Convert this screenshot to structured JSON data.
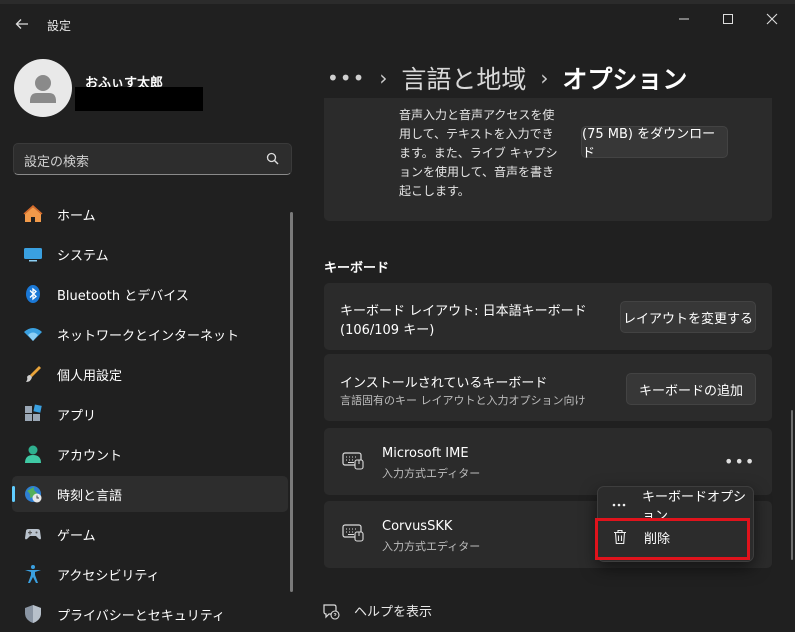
{
  "app": {
    "title": "設定"
  },
  "profile": {
    "name": "おふぃす太郎"
  },
  "search": {
    "placeholder": "設定の検索"
  },
  "nav": [
    {
      "label": "ホーム",
      "icon": "home-icon"
    },
    {
      "label": "システム",
      "icon": "system-icon"
    },
    {
      "label": "Bluetooth とデバイス",
      "icon": "bluetooth-icon"
    },
    {
      "label": "ネットワークとインターネット",
      "icon": "wifi-icon"
    },
    {
      "label": "個人用設定",
      "icon": "brush-icon"
    },
    {
      "label": "アプリ",
      "icon": "apps-icon"
    },
    {
      "label": "アカウント",
      "icon": "account-icon"
    },
    {
      "label": "時刻と言語",
      "icon": "time-language-icon",
      "active": true
    },
    {
      "label": "ゲーム",
      "icon": "game-controller-icon"
    },
    {
      "label": "アクセシビリティ",
      "icon": "accessibility-icon"
    },
    {
      "label": "プライバシーとセキュリティ",
      "icon": "shield-icon"
    }
  ],
  "breadcrumb": {
    "more": "•••",
    "parent": "言語と地域",
    "current": "オプション"
  },
  "speech": {
    "description": "音声入力と音声アクセスを使用して、テキストを入力できます。また、ライブ キャプションを使用して、音声を書き起こします。",
    "download_label": "(75 MB) をダウンロード"
  },
  "keyboard": {
    "section_title": "キーボード",
    "layout_title": "キーボード レイアウト: 日本語キーボード",
    "layout_sub": "(106/109 キー)",
    "change_layout_label": "レイアウトを変更する",
    "installed_title": "インストールされているキーボード",
    "installed_sub": "言語固有のキー レイアウトと入力オプション向け",
    "add_keyboard_label": "キーボードの追加",
    "items": [
      {
        "name": "Microsoft IME",
        "sub": "入力方式エディター"
      },
      {
        "name": "CorvusSKK",
        "sub": "入力方式エディター"
      }
    ]
  },
  "context_menu": {
    "options_label": "キーボードオプション",
    "delete_label": "削除"
  },
  "help": {
    "label": "ヘルプを表示"
  },
  "colors": {
    "accent": "#60cdff",
    "highlight": "#e0131c",
    "background": "#202020",
    "card": "#2b2b2b"
  }
}
